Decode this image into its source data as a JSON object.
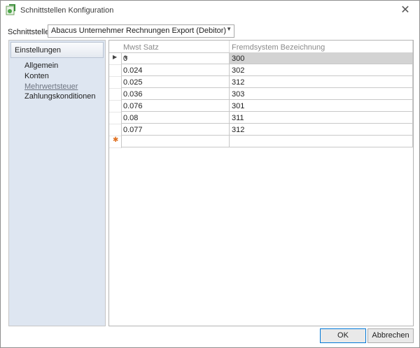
{
  "window": {
    "title": "Schnittstellen Konfiguration"
  },
  "icons": {
    "app": "app-logo-icon",
    "close": "close-icon",
    "dropdown": "chevron-down-icon",
    "row_current": "row-indicator-arrow-icon",
    "row_new": "new-row-star-icon"
  },
  "interface_selector": {
    "label": "Schnittstelle",
    "value": "Abacus Unternehmer Rechnungen Export (Debitor)"
  },
  "sidebar": {
    "header": "Einstellungen",
    "items": [
      {
        "label": "Allgemein"
      },
      {
        "label": "Konten"
      },
      {
        "label": "Mehrwertsteuer"
      },
      {
        "label": "Zahlungskonditionen"
      }
    ],
    "active_index": 2
  },
  "grid": {
    "columns": [
      "Mwst Satz",
      "Fremdsystem Bezeichnung"
    ],
    "rows": [
      {
        "rate": "0",
        "code": "300"
      },
      {
        "rate": "0.024",
        "code": "302"
      },
      {
        "rate": "0.025",
        "code": "312"
      },
      {
        "rate": "0.036",
        "code": "303"
      },
      {
        "rate": "0.076",
        "code": "301"
      },
      {
        "rate": "0.08",
        "code": "311"
      },
      {
        "rate": "0.077",
        "code": "312"
      }
    ]
  },
  "buttons": {
    "ok": "OK",
    "cancel": "Abbrechen"
  }
}
